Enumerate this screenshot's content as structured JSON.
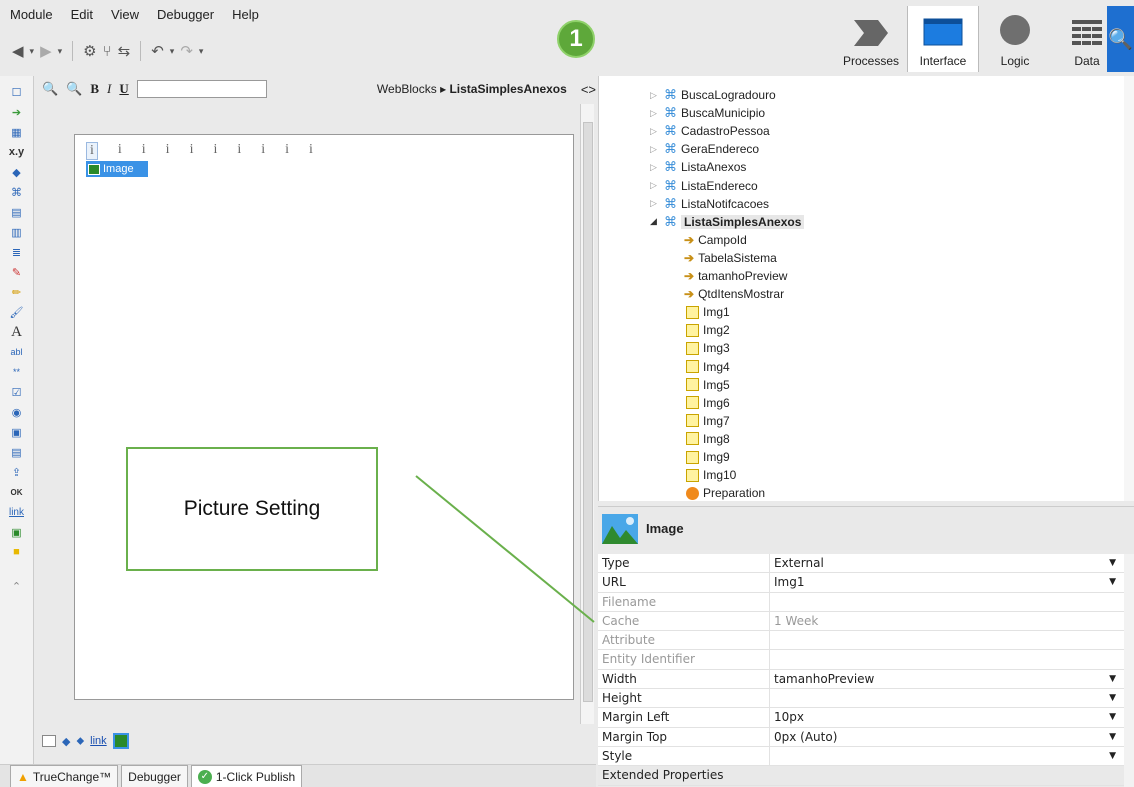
{
  "menu": [
    "Module",
    "Edit",
    "View",
    "Debugger",
    "Help"
  ],
  "badge": "1",
  "tabs": [
    {
      "label": "Processes",
      "icon": "processes-icon"
    },
    {
      "label": "Interface",
      "icon": "interface-icon"
    },
    {
      "label": "Logic",
      "icon": "logic-icon"
    },
    {
      "label": "Data",
      "icon": "data-icon"
    }
  ],
  "canvas": {
    "breadcrumb_root": "WebBlocks",
    "breadcrumb_current": "ListaSimplesAnexos",
    "image_widget_label": "Image",
    "expression_glyph": "i"
  },
  "callout": "Picture Setting",
  "bottom_widgets_link": "link",
  "bottom_tabs": [
    "TrueChange™",
    "Debugger",
    "1-Click Publish"
  ],
  "tree": {
    "items": [
      "BuscaLogradouro",
      "BuscaMunicipio",
      "CadastroPessoa",
      "GeraEndereco",
      "ListaAnexos",
      "ListaEndereco",
      "ListaNotifcacoes"
    ],
    "selected": "ListaSimplesAnexos",
    "inputs": [
      "CampoId",
      "TabelaSistema",
      "tamanhoPreview",
      "QtdItensMostrar"
    ],
    "vars": [
      "Img1",
      "Img2",
      "Img3",
      "Img4",
      "Img5",
      "Img6",
      "Img7",
      "Img8",
      "Img9",
      "Img10"
    ],
    "action": "Preparation"
  },
  "properties": {
    "title": "Image",
    "rows": [
      {
        "name": "Type",
        "value": "External",
        "dropdown": true,
        "grey": false
      },
      {
        "name": "URL",
        "value": "Img1",
        "dropdown": true,
        "grey": false
      },
      {
        "name": "Filename",
        "value": "",
        "dropdown": false,
        "grey": true
      },
      {
        "name": "Cache",
        "value": "1 Week",
        "dropdown": false,
        "grey": true
      },
      {
        "name": "Attribute",
        "value": "",
        "dropdown": false,
        "grey": true
      },
      {
        "name": "Entity Identifier",
        "value": "",
        "dropdown": false,
        "grey": true
      },
      {
        "name": "Width",
        "value": "tamanhoPreview",
        "dropdown": true,
        "grey": false
      },
      {
        "name": "Height",
        "value": "",
        "dropdown": true,
        "grey": false
      },
      {
        "name": "Margin Left",
        "value": "10px",
        "dropdown": true,
        "grey": false
      },
      {
        "name": "Margin Top",
        "value": "0px (Auto)",
        "dropdown": true,
        "grey": false
      },
      {
        "name": "Style",
        "value": "",
        "dropdown": true,
        "grey": false
      },
      {
        "name": "Extended Properties",
        "value": "",
        "dropdown": false,
        "grey": false
      }
    ]
  }
}
